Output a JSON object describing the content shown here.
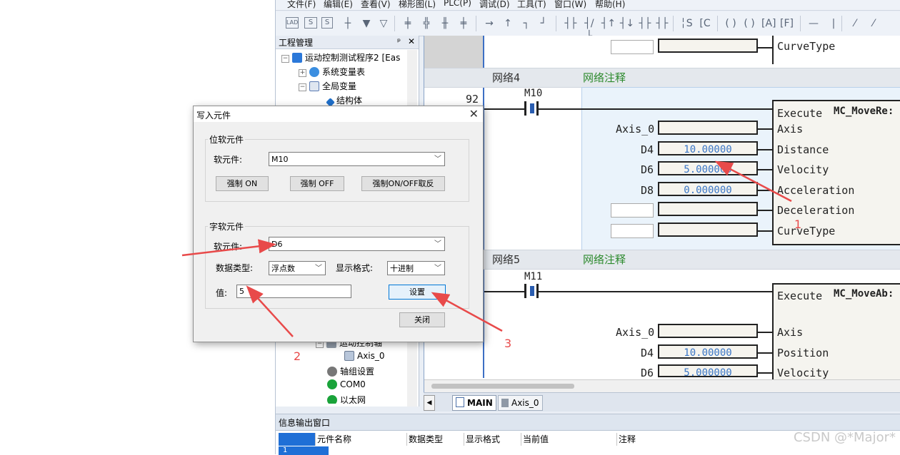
{
  "menu": [
    "文件(F)",
    "编辑(E)",
    "查看(V)",
    "梯形图(L)",
    "PLC(P)",
    "调试(D)",
    "工具(T)",
    "窗口(W)",
    "帮助(H)"
  ],
  "project_panel": {
    "title": "工程管理",
    "pin": "ᵖ",
    "close": "✕",
    "items": [
      {
        "label": "运动控制测试程序2 [Eas"
      },
      {
        "label": "系统变量表"
      },
      {
        "label": "全局变量"
      },
      {
        "label": "结构体"
      },
      {
        "label": "运动控制轴"
      },
      {
        "label": "Axis_0"
      },
      {
        "label": "轴组设置"
      },
      {
        "label": "COM0"
      },
      {
        "label": "以太网"
      }
    ]
  },
  "ladder": {
    "top_row": {
      "pin": "CurveType"
    },
    "rung_num": "92",
    "net4": {
      "label": "网络4",
      "comment": "网络注释",
      "contact": "M10",
      "block": "MC_MoveRe:",
      "inputs": [
        {
          "var": "",
          "value": "",
          "pin": "Execute"
        },
        {
          "var": "Axis_0",
          "value": "",
          "pin": "Axis"
        },
        {
          "var": "D4",
          "value": "10.00000",
          "pin": "Distance"
        },
        {
          "var": "D6",
          "value": "5.000000",
          "pin": "Velocity"
        },
        {
          "var": "D8",
          "value": "0.000000",
          "pin": "Acceleration"
        },
        {
          "var": "",
          "value": "",
          "pin": "Deceleration"
        },
        {
          "var": "",
          "value": "",
          "pin": "CurveType"
        }
      ]
    },
    "net5": {
      "label": "网络5",
      "comment": "网络注释",
      "contact": "M11",
      "block": "MC_MoveAb:",
      "inputs": [
        {
          "var": "",
          "value": "",
          "pin": "Execute"
        },
        {
          "var": "Axis_0",
          "value": "",
          "pin": "Axis"
        },
        {
          "var": "D4",
          "value": "10.00000",
          "pin": "Position"
        },
        {
          "var": "D6",
          "value": "5.000000",
          "pin": "Velocity"
        }
      ]
    }
  },
  "tabs": [
    {
      "label": "MAIN"
    },
    {
      "label": "Axis_0"
    }
  ],
  "output": {
    "title": "信息输出窗口",
    "columns": [
      "元件名称",
      "数据类型",
      "显示格式",
      "当前值",
      "注释"
    ],
    "row_num": "1"
  },
  "dialog": {
    "title": "写入元件",
    "close": "✕",
    "bit_group": "位软元件",
    "bit_label": "软元件:",
    "bit_value": "M10",
    "btn_on": "强制 ON",
    "btn_off": "强制 OFF",
    "btn_toggle": "强制ON/OFF取反",
    "word_group": "字软元件",
    "word_label": "软元件:",
    "word_value": "D6",
    "dtype_label": "数据类型:",
    "dtype_value": "浮点数",
    "fmt_label": "显示格式:",
    "fmt_value": "十进制",
    "val_label": "值:",
    "val_value": "5",
    "set_btn": "设置",
    "close_btn": "关闭"
  },
  "annotations": {
    "a1": "1",
    "a2": "2",
    "a3": "3"
  },
  "watermark": "CSDN @*Major*",
  "colors": {
    "annotation": "#e84a4a",
    "value_text": "#3a76c6",
    "comment_green": "#2d8a2d",
    "rail_blue": "#3d6fc4"
  }
}
